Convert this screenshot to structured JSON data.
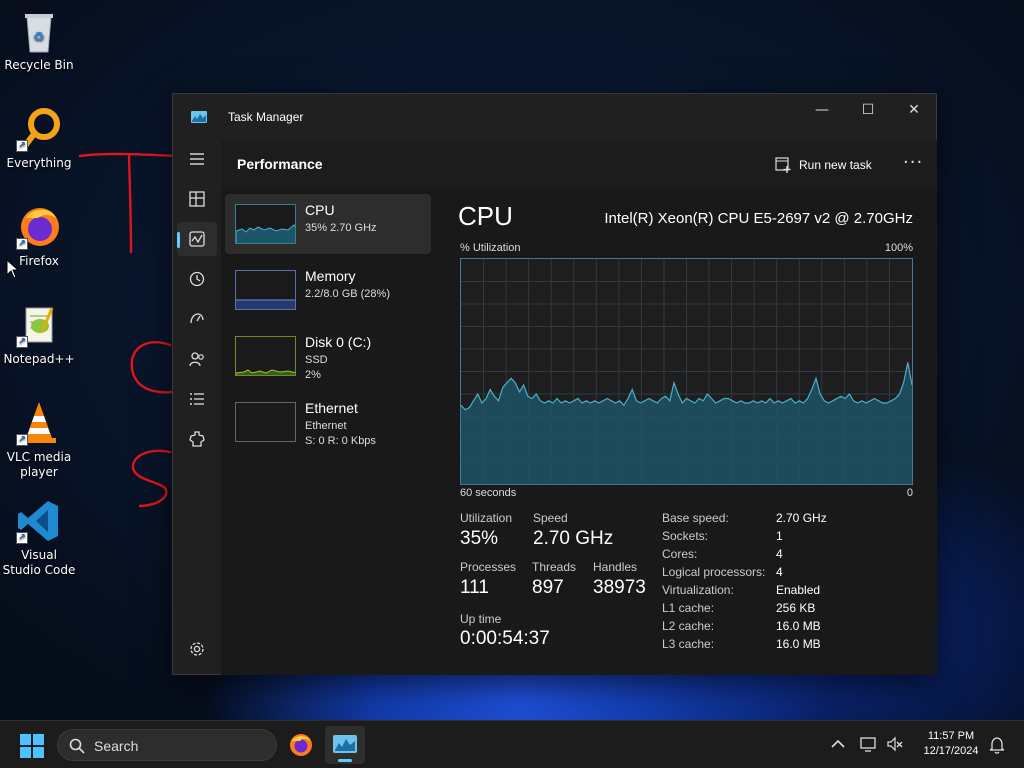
{
  "desktop": {
    "icons": [
      {
        "label": "Recycle Bin"
      },
      {
        "label": "Everything"
      },
      {
        "label": "Firefox"
      },
      {
        "label": "Notepad++"
      },
      {
        "label": "VLC media player"
      },
      {
        "label": "Visual Studio Code"
      }
    ]
  },
  "window": {
    "title": "Task Manager",
    "controls": {
      "minimize": "—",
      "maximize": "☐",
      "close": "✕"
    }
  },
  "header": {
    "title": "Performance",
    "run_new_task": "Run new task",
    "more": "···"
  },
  "nav": {
    "items": [
      "menu-icon",
      "processes-icon",
      "performance-icon",
      "app-history-icon",
      "startup-apps-icon",
      "users-icon",
      "details-icon",
      "services-icon",
      "settings-icon"
    ],
    "active": "performance-icon"
  },
  "resources": [
    {
      "name": "CPU",
      "sub1": "35%  2.70 GHz",
      "sub2": "",
      "sub3": ""
    },
    {
      "name": "Memory",
      "sub1": "2.2/8.0 GB (28%)",
      "sub2": "",
      "sub3": ""
    },
    {
      "name": "Disk 0 (C:)",
      "sub1": "SSD",
      "sub2": "2%",
      "sub3": ""
    },
    {
      "name": "Ethernet",
      "sub1": "Ethernet",
      "sub2": "S: 0 R: 0 Kbps",
      "sub3": ""
    }
  ],
  "detail": {
    "heading": "CPU",
    "model": "Intel(R) Xeon(R) CPU E5-2697 v2 @ 2.70GHz",
    "graph_label": "% Utilization",
    "graph_max": "100%",
    "graph_time": "60 seconds",
    "graph_min": "0",
    "stats": {
      "utilization_label": "Utilization",
      "utilization": "35%",
      "speed_label": "Speed",
      "speed": "2.70 GHz",
      "processes_label": "Processes",
      "processes": "111",
      "threads_label": "Threads",
      "threads": "897",
      "handles_label": "Handles",
      "handles": "38973",
      "uptime_label": "Up time",
      "uptime": "0:00:54:37"
    },
    "specs": [
      {
        "k": "Base speed:",
        "v": "2.70 GHz"
      },
      {
        "k": "Sockets:",
        "v": "1"
      },
      {
        "k": "Cores:",
        "v": "4"
      },
      {
        "k": "Logical processors:",
        "v": "4"
      },
      {
        "k": "Virtualization:",
        "v": "Enabled"
      },
      {
        "k": "L1 cache:",
        "v": "256 KB"
      },
      {
        "k": "L2 cache:",
        "v": "16.0 MB"
      },
      {
        "k": "L3 cache:",
        "v": "16.0 MB"
      }
    ],
    "cpu_history": [
      35,
      33,
      34,
      37,
      40,
      36,
      38,
      42,
      39,
      37,
      43,
      45,
      47,
      45,
      41,
      44,
      39,
      38,
      40,
      37,
      36,
      37,
      36,
      38,
      36,
      37,
      36,
      37,
      38,
      36,
      37,
      36,
      37,
      36,
      37,
      38,
      37,
      36,
      37,
      35,
      38,
      42,
      37,
      36,
      37,
      38,
      37,
      36,
      38,
      39,
      37,
      45,
      40,
      36,
      38,
      37,
      36,
      38,
      37,
      40,
      38,
      36,
      37,
      38,
      38,
      37,
      36,
      37,
      36,
      36,
      37,
      36,
      37,
      36,
      38,
      36,
      37,
      36,
      37,
      38,
      36,
      37,
      36,
      38,
      42,
      47,
      40,
      37,
      36,
      37,
      38,
      39,
      38,
      40,
      37,
      36,
      37,
      36,
      37,
      38,
      37,
      36,
      36,
      37,
      38,
      40,
      45,
      54,
      44
    ]
  },
  "taskbar": {
    "search_placeholder": "Search",
    "time": "11:57 PM",
    "date": "12/17/2024",
    "accent": "#60cdff"
  },
  "colors": {
    "graph_line": "#4ab0cc",
    "graph_fill": "#1d5467",
    "annotation": "#e0161b"
  }
}
